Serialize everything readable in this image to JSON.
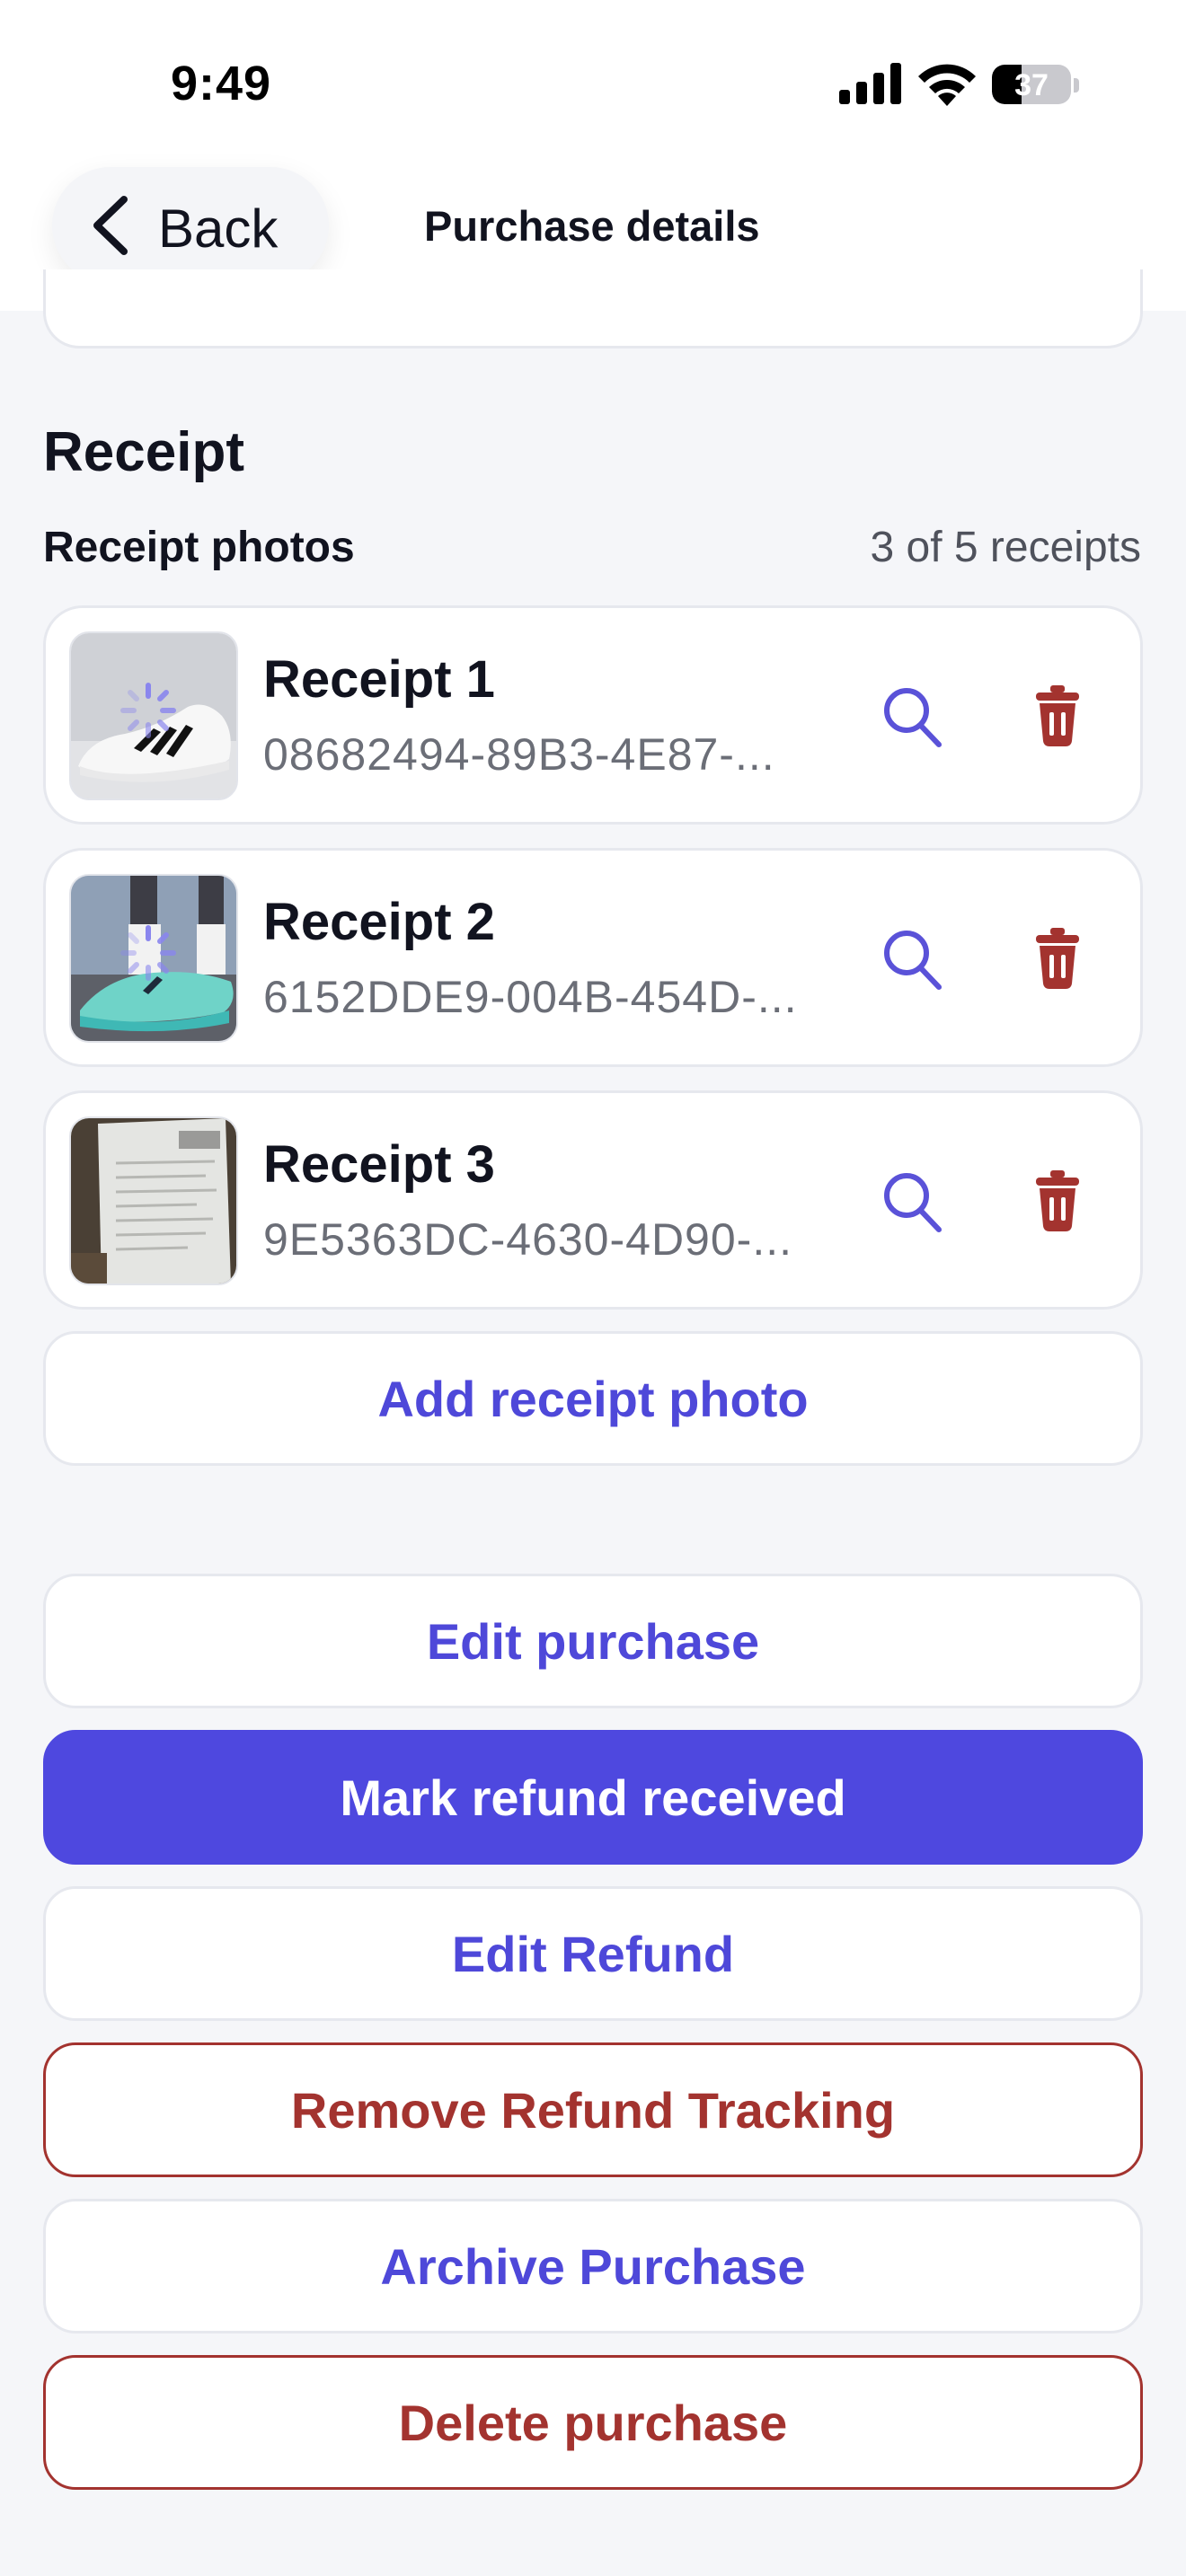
{
  "status_bar": {
    "time": "9:49",
    "battery": "37",
    "battery_level": 0.37
  },
  "header": {
    "back_label": "Back",
    "title": "Purchase details"
  },
  "receipt_section": {
    "title": "Receipt",
    "photos_label": "Receipt photos",
    "count_text": "3 of 5 receipts",
    "items": [
      {
        "title": "Receipt 1",
        "id": "08682494-89B3-4E87-..."
      },
      {
        "title": "Receipt 2",
        "id": "6152DDE9-004B-454D-..."
      },
      {
        "title": "Receipt 3",
        "id": "9E5363DC-4630-4D90-..."
      }
    ],
    "add_label": "Add receipt photo"
  },
  "actions": {
    "edit_purchase": "Edit purchase",
    "mark_refund_received": "Mark refund received",
    "edit_refund": "Edit Refund",
    "remove_refund_tracking": "Remove Refund Tracking",
    "archive_purchase": "Archive Purchase",
    "delete_purchase": "Delete purchase"
  },
  "colors": {
    "accent": "#4e48df",
    "danger": "#a3332f",
    "background": "#f5f6f9"
  },
  "icons": [
    "back-chevron-icon",
    "search-icon",
    "trash-icon",
    "loading-spinner-icon",
    "cellular-signal-icon",
    "wifi-icon",
    "battery-icon"
  ]
}
